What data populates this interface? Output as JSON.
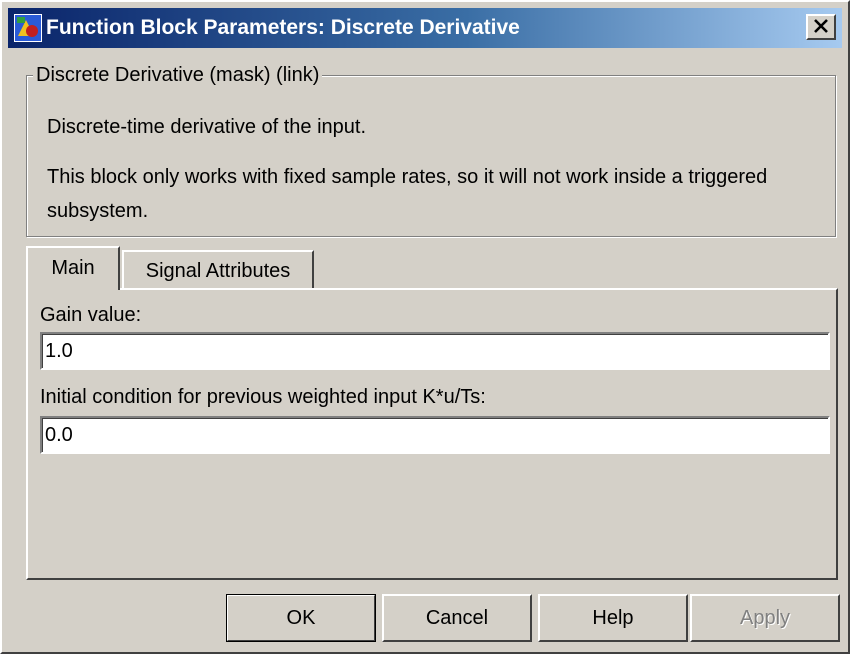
{
  "window": {
    "title": "Function Block Parameters: Discrete Derivative"
  },
  "description": {
    "group_title": "Discrete Derivative (mask) (link)",
    "line1": "Discrete-time derivative of the input.",
    "line2": "This block only works with fixed sample rates, so it will not work inside a triggered",
    "line3": "subsystem."
  },
  "tabs": [
    {
      "label": "Main",
      "active": true
    },
    {
      "label": "Signal Attributes",
      "active": false
    }
  ],
  "fields": {
    "gain": {
      "label": "Gain value:",
      "value": "1.0"
    },
    "initial_condition": {
      "label": "Initial condition for previous weighted input K*u/Ts:",
      "value": "0.0"
    }
  },
  "buttons": {
    "ok": "OK",
    "cancel": "Cancel",
    "help": "Help",
    "apply": "Apply"
  },
  "icons": {
    "app": "simulink-block-icon",
    "close": "close-icon"
  },
  "colors": {
    "title_gradient_start": "#0a246a",
    "title_gradient_end": "#a6caf0",
    "dialog_face": "#d4d0c8",
    "disabled_text": "#808080"
  }
}
